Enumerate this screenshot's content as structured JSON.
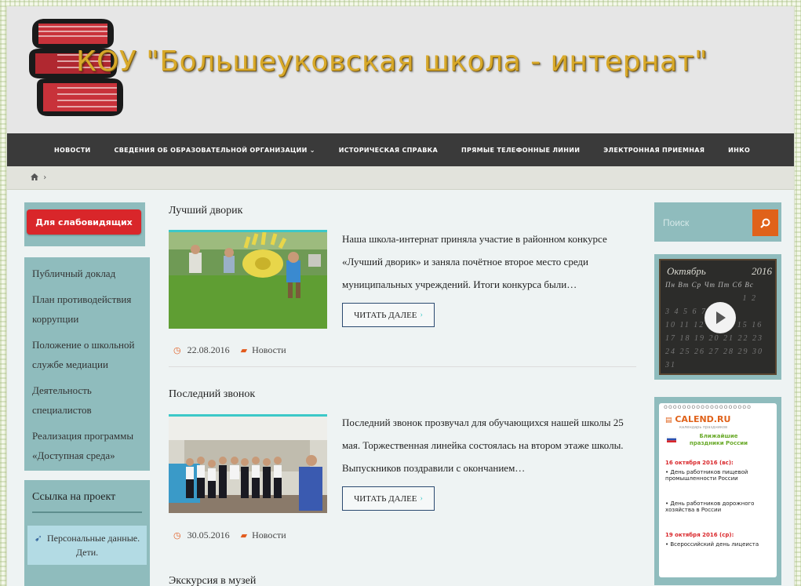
{
  "header": {
    "site_title": "КОУ \"Большеуковская школа - интернат\""
  },
  "nav": {
    "items": [
      "НОВОСТИ",
      "СВЕДЕНИЯ ОБ ОБРАЗОВАТЕЛЬНОЙ ОРГАНИЗАЦИИ",
      "ИСТОРИЧЕСКАЯ СПРАВКА",
      "ПРЯМЫЕ ТЕЛЕФОННЫЕ ЛИНИИ",
      "ЭЛЕКТРОННАЯ ПРИЕМНАЯ",
      "ИНКО"
    ],
    "dropdown_indicator": "⌄"
  },
  "breadcrumb": {
    "home_icon": "home-icon",
    "separator": "›"
  },
  "left_sidebar": {
    "accessibility_button": "Для слабовидящих",
    "links": [
      "Публичный доклад",
      "План противодействия коррупции",
      "Положение о школьной службе медиации",
      "Деятельность специалистов",
      "Реализация программы «Доступная среда»"
    ],
    "project_widget": {
      "title": "Ссылка на проект",
      "card_text": "Персональные данные. Дети."
    }
  },
  "posts": [
    {
      "title": "Лучший дворик",
      "excerpt": "Наша школа-интернат приняла участие в районном конкурсе «Лучший дворик» и заняла почётное второе место среди муниципальных учреждений. Итоги конкурса были…",
      "read_more": "ЧИТАТЬ ДАЛЕЕ",
      "date": "22.08.2016",
      "category": "Новости"
    },
    {
      "title": "Последний звонок",
      "excerpt": "Последний звонок прозвучал для обучающихся нашей школы 25 мая. Торжественная линейка состоялась на втором этаже школы. Выпускников поздравили с окончанием…",
      "read_more": "ЧИТАТЬ ДАЛЕЕ",
      "date": "30.05.2016",
      "category": "Новости"
    },
    {
      "title": "Экскурсия в музей"
    }
  ],
  "right_sidebar": {
    "search": {
      "placeholder": "Поиск"
    },
    "calendar_board": {
      "month": "Октябрь",
      "year": "2016",
      "weekdays": "Пн Вт Ср Чт Пт Сб Вс",
      "rows": [
        "1 2",
        "3 4 5 6 7 8 9",
        "10 11 12 13 14 15 16",
        "17 18 19 20 21 22 23",
        "24 25 26 27 28 29 30",
        "31"
      ]
    },
    "calend": {
      "logo": "CALEND.RU",
      "tagline": "календарь праздников",
      "heading": "Ближайшие праздники России",
      "events": [
        {
          "date": "16 октября 2016 (вс):",
          "title": "День работников пищевой промышленности России"
        },
        {
          "date": "",
          "title": "День работников дорожного хозяйства в России"
        },
        {
          "date": "19 октября 2016 (ср):",
          "title": "Всероссийский день лицеиста"
        }
      ]
    }
  },
  "colors": {
    "accent": "#3cc8c8",
    "orange": "#e0621a",
    "widget": "#8fbcbd",
    "nav": "#3a3a3a",
    "red": "#d9262a"
  }
}
